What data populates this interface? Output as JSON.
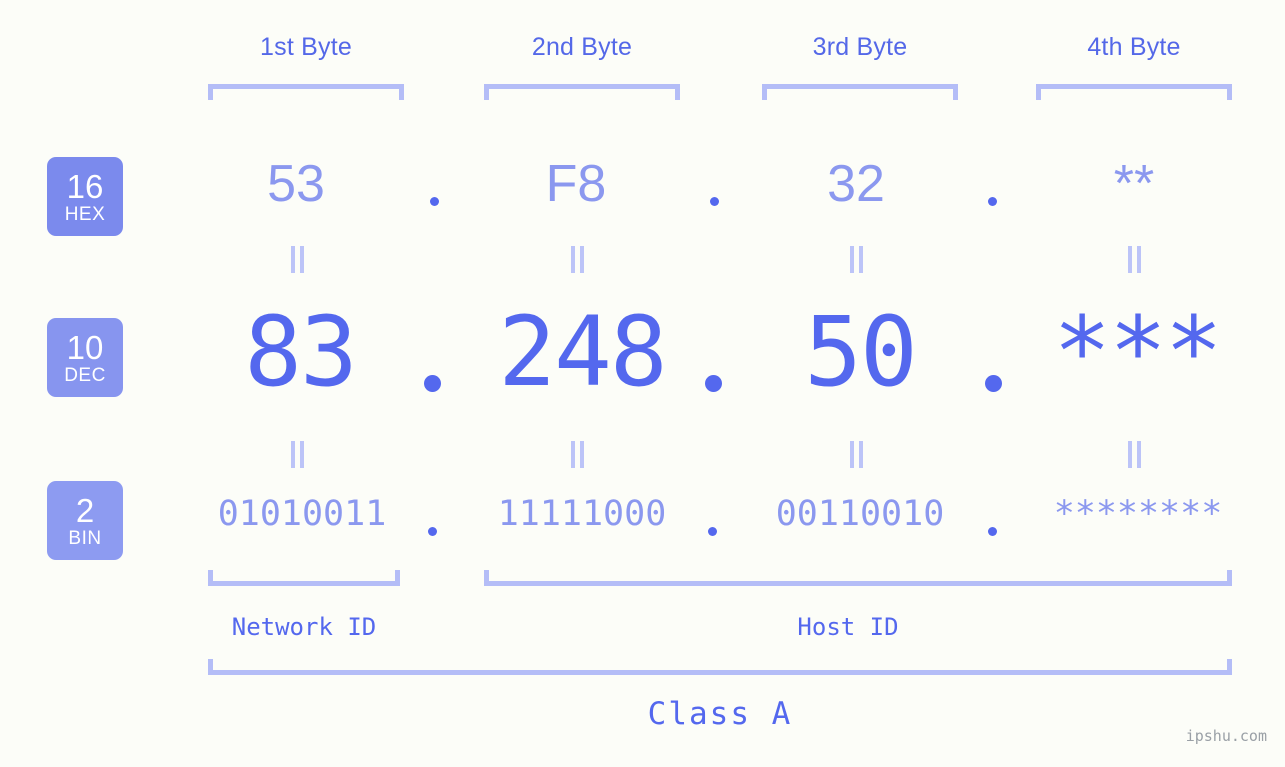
{
  "page": {
    "background_color": "#fcfdf8",
    "accent_color": "#5468ee",
    "accent_light_color": "#8b98ef",
    "bracket_color": "#b4bdf7",
    "badge_color": "#7d8ced",
    "watermark": "ipshu.com"
  },
  "byte_headers": [
    {
      "label": "1st Byte"
    },
    {
      "label": "2nd Byte"
    },
    {
      "label": "3rd Byte"
    },
    {
      "label": "4th Byte"
    }
  ],
  "rows": [
    {
      "base_number": "16",
      "base_name": "HEX",
      "values": [
        "53",
        "F8",
        "32",
        "**"
      ],
      "separator": "."
    },
    {
      "base_number": "10",
      "base_name": "DEC",
      "values": [
        "83",
        "248",
        "50",
        "***"
      ],
      "separator": "."
    },
    {
      "base_number": "2",
      "base_name": "BIN",
      "values": [
        "01010011",
        "11111000",
        "00110010",
        "********"
      ],
      "separator": "."
    }
  ],
  "equals_symbol": "=",
  "sections": [
    {
      "label": "Network ID"
    },
    {
      "label": "Host ID"
    }
  ],
  "class": {
    "label": "Class A"
  }
}
